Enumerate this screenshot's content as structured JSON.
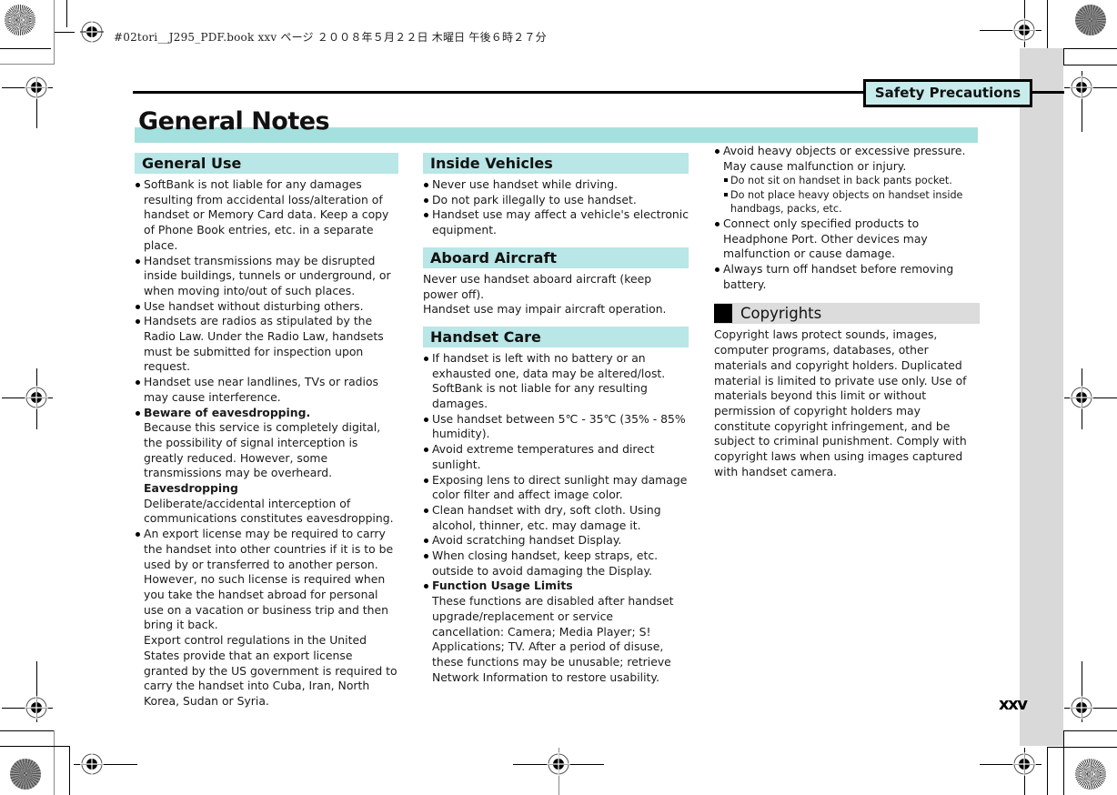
{
  "print_header": "#02tori__J295_PDF.book  xxv ページ  ２００８年５月２２日  木曜日  午後６時２７分",
  "chapter_tab": "Safety Precautions",
  "page_title": "General Notes",
  "page_number": "xxv",
  "columns": {
    "general_use": {
      "heading": "General Use",
      "items": [
        "SoftBank is not liable for any damages resulting from accidental loss/alteration of handset or Memory Card data. Keep a copy of Phone Book entries, etc. in a separate place.",
        "Handset transmissions may be disrupted inside buildings, tunnels or underground, or when moving into/out of such places.",
        "Use handset without disturbing others.",
        "Handsets are radios as stipulated by the Radio Law. Under the Radio Law, handsets must be submitted for inspection upon request.",
        "Handset use near landlines, TVs or radios may cause interference."
      ],
      "eavesdrop": {
        "title": "Beware of eavesdropping.",
        "body": "Because this service is completely digital, the possibility of signal interception is greatly reduced. However, some transmissions may be overheard.",
        "term": "Eavesdropping",
        "definition": "Deliberate/accidental interception of communications constitutes eavesdropping."
      },
      "export": {
        "body1": "An export license may be required to carry the handset into other countries if it is to be used by or transferred to another person. However, no such license is required when you take the handset abroad for personal use on a vacation or business trip and then bring it back.",
        "body2": "Export control regulations in the United States provide that an export license granted by the US government is required to carry the handset into Cuba, Iran, North Korea, Sudan or Syria."
      }
    },
    "inside_vehicles": {
      "heading": "Inside Vehicles",
      "items": [
        "Never use handset while driving.",
        "Do not park illegally to use handset.",
        "Handset use may affect a vehicle's electronic equipment."
      ]
    },
    "aboard_aircraft": {
      "heading": "Aboard Aircraft",
      "line1": "Never use handset aboard aircraft (keep power off).",
      "line2": "Handset use may impair aircraft operation."
    },
    "handset_care": {
      "heading": "Handset Care",
      "items": [
        "If handset is left with no battery or an exhausted one, data may be altered/lost. SoftBank is not liable for any resulting damages.",
        "Use handset between 5℃ - 35℃ (35% - 85% humidity).",
        "Avoid extreme temperatures and direct sunlight.",
        "Exposing lens to direct sunlight may damage color filter and affect image color.",
        "Clean handset with dry, soft cloth. Using alcohol, thinner, etc. may damage it.",
        "Avoid scratching handset Display.",
        "When closing handset, keep straps, etc. outside to avoid damaging the Display."
      ],
      "function_limits": {
        "title": "Function Usage Limits",
        "body": "These functions are disabled after handset upgrade/replacement or service cancellation: Camera; Media Player; S! Applications; TV. After a period of disuse, these functions may be unusable; retrieve Network Information to restore usability."
      },
      "continued": {
        "pressure": "Avoid heavy objects or excessive pressure. May cause malfunction or injury.",
        "sub_items": [
          "Do not sit on handset in back pants pocket.",
          "Do not place heavy objects on handset inside handbags, packs, etc."
        ],
        "items": [
          "Connect only specified products to Headphone Port. Other devices may malfunction or cause damage.",
          "Always turn off handset before removing battery."
        ]
      }
    },
    "copyrights": {
      "heading": "Copyrights",
      "body": "Copyright laws protect sounds, images, computer programs, databases, other materials and copyright holders. Duplicated material is limited to private use only. Use of materials beyond this limit or without permission of copyright holders may constitute copyright infringement, and be subject to criminal punishment. Comply with copyright laws when using images captured with handset camera."
    }
  },
  "colors": {
    "title_band": "#a6e0de",
    "section_band": "#b9e6e6",
    "tab_fill": "#c8ecec",
    "margin_strip": "#d9d9d9"
  }
}
